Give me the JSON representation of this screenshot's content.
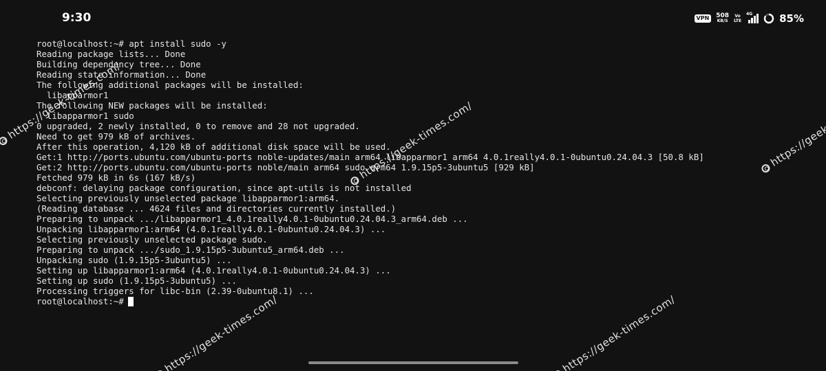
{
  "status_bar": {
    "time": "9:30",
    "vpn_label": "VPN",
    "net_speed": "508",
    "net_speed_unit": "KB/S",
    "volte_top": "Vo",
    "volte_bottom": "LTE",
    "network_type": "4G",
    "battery_percent": "85%",
    "battery_level": 0.85
  },
  "terminal": {
    "lines": [
      "root@localhost:~# apt install sudo -y",
      "Reading package lists... Done",
      "Building dependency tree... Done",
      "Reading state information... Done",
      "The following additional packages will be installed:",
      "  libapparmor1",
      "The following NEW packages will be installed:",
      "  libapparmor1 sudo",
      "0 upgraded, 2 newly installed, 0 to remove and 28 not upgraded.",
      "Need to get 979 kB of archives.",
      "After this operation, 4,120 kB of additional disk space will be used.",
      "Get:1 http://ports.ubuntu.com/ubuntu-ports noble-updates/main arm64 libapparmor1 arm64 4.0.1really4.0.1-0ubuntu0.24.04.3 [50.8 kB]",
      "Get:2 http://ports.ubuntu.com/ubuntu-ports noble/main arm64 sudo arm64 1.9.15p5-3ubuntu5 [929 kB]",
      "Fetched 979 kB in 6s (167 kB/s)",
      "debconf: delaying package configuration, since apt-utils is not installed",
      "Selecting previously unselected package libapparmor1:arm64.",
      "(Reading database ... 4624 files and directories currently installed.)",
      "Preparing to unpack .../libapparmor1_4.0.1really4.0.1-0ubuntu0.24.04.3_arm64.deb ...",
      "Unpacking libapparmor1:arm64 (4.0.1really4.0.1-0ubuntu0.24.04.3) ...",
      "Selecting previously unselected package sudo.",
      "Preparing to unpack .../sudo_1.9.15p5-3ubuntu5_arm64.deb ...",
      "Unpacking sudo (1.9.15p5-3ubuntu5) ...",
      "Setting up libapparmor1:arm64 (4.0.1really4.0.1-0ubuntu0.24.04.3) ...",
      "Setting up sudo (1.9.15p5-3ubuntu5) ...",
      "Processing triggers for libc-bin (2.39-0ubuntu8.1) ..."
    ],
    "prompt": "root@localhost:~#"
  },
  "watermark": {
    "text": "https://geek-times.com/"
  },
  "icons": {
    "vpn": "vpn-icon",
    "signal": "signal-icon",
    "battery": "battery-ring-icon",
    "cursor": "cursor-block",
    "watermark_logo": "watermark-logo-icon"
  }
}
